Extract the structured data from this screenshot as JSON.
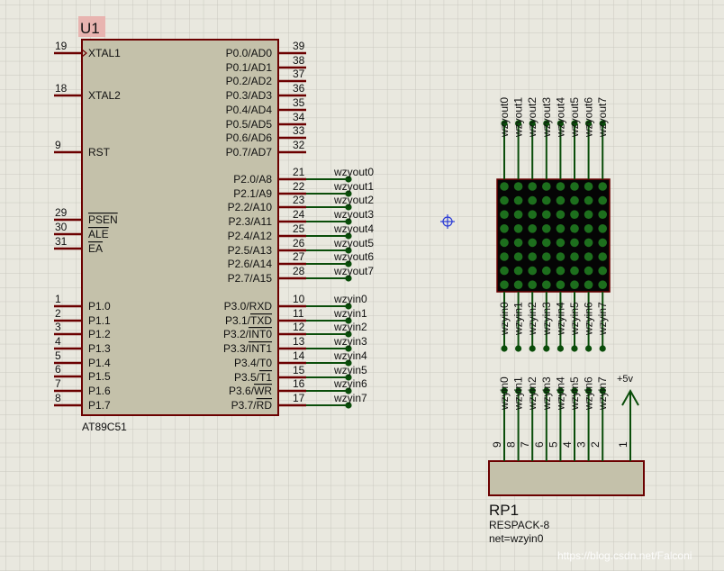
{
  "u1": {
    "ref": "U1",
    "part": "AT89C51",
    "left_pins": [
      {
        "num": "19",
        "name": "XTAL1",
        "clock": true
      },
      {
        "num": "18",
        "name": "XTAL2"
      },
      {
        "num": "9",
        "name": "RST"
      },
      {
        "num": "29",
        "name": "PSEN",
        "overbar": true
      },
      {
        "num": "30",
        "name": "ALE",
        "overbar": true
      },
      {
        "num": "31",
        "name": "EA",
        "overbar": true
      },
      {
        "num": "1",
        "name": "P1.0"
      },
      {
        "num": "2",
        "name": "P1.1"
      },
      {
        "num": "3",
        "name": "P1.2"
      },
      {
        "num": "4",
        "name": "P1.3"
      },
      {
        "num": "5",
        "name": "P1.4"
      },
      {
        "num": "6",
        "name": "P1.5"
      },
      {
        "num": "7",
        "name": "P1.6"
      },
      {
        "num": "8",
        "name": "P1.7"
      }
    ],
    "right_pins": [
      {
        "num": "39",
        "name": "P0.0/AD0"
      },
      {
        "num": "38",
        "name": "P0.1/AD1"
      },
      {
        "num": "37",
        "name": "P0.2/AD2"
      },
      {
        "num": "36",
        "name": "P0.3/AD3"
      },
      {
        "num": "35",
        "name": "P0.4/AD4"
      },
      {
        "num": "34",
        "name": "P0.5/AD5"
      },
      {
        "num": "33",
        "name": "P0.6/AD6"
      },
      {
        "num": "32",
        "name": "P0.7/AD7"
      },
      {
        "num": "21",
        "name": "P2.0/A8",
        "net": "wzyout0"
      },
      {
        "num": "22",
        "name": "P2.1/A9",
        "net": "wzyout1"
      },
      {
        "num": "23",
        "name": "P2.2/A10",
        "net": "wzyout2"
      },
      {
        "num": "24",
        "name": "P2.3/A11",
        "net": "wzyout3"
      },
      {
        "num": "25",
        "name": "P2.4/A12",
        "net": "wzyout4"
      },
      {
        "num": "26",
        "name": "P2.5/A13",
        "net": "wzyout5"
      },
      {
        "num": "27",
        "name": "P2.6/A14",
        "net": "wzyout6"
      },
      {
        "num": "28",
        "name": "P2.7/A15",
        "net": "wzyout7"
      },
      {
        "num": "10",
        "name": "P3.0/RXD",
        "net": "wzyin0"
      },
      {
        "num": "11",
        "name": "P3.1/TXD",
        "net": "wzyin1",
        "bar": "TXD"
      },
      {
        "num": "12",
        "name": "P3.2/INT0",
        "net": "wzyin2",
        "bar": "INT0"
      },
      {
        "num": "13",
        "name": "P3.3/INT1",
        "net": "wzyin3",
        "bar": "INT1"
      },
      {
        "num": "14",
        "name": "P3.4/T0",
        "net": "wzyin4"
      },
      {
        "num": "15",
        "name": "P3.5/T1",
        "net": "wzyin5",
        "bar": "T1"
      },
      {
        "num": "16",
        "name": "P3.6/WR",
        "net": "wzyin6",
        "bar": "WR"
      },
      {
        "num": "17",
        "name": "P3.7/RD",
        "net": "wzyin7",
        "bar": "RD"
      }
    ]
  },
  "matrix": {
    "top_nets": [
      "wzyout0",
      "wzyout1",
      "wzyout2",
      "wzyout3",
      "wzyout4",
      "wzyout5",
      "wzyout6",
      "wzyout7"
    ],
    "bottom_nets": [
      "wzyin0",
      "wzyin1",
      "wzyin2",
      "wzyin3",
      "wzyin4",
      "wzyin5",
      "wzyin6",
      "wzyin7"
    ],
    "rows": 8,
    "cols": 8,
    "dot_color": "#1d6f1d",
    "body_color": "#050505"
  },
  "rp1": {
    "ref": "RP1",
    "part": "RESPACK-8",
    "net_label": "net=wzyin0",
    "nets": [
      "wzyin0",
      "wzyin1",
      "wzyin2",
      "wzyin3",
      "wzyin4",
      "wzyin5",
      "wzyin6",
      "wzyin7"
    ],
    "pin_numbers": [
      "9",
      "8",
      "7",
      "6",
      "5",
      "4",
      "3",
      "2"
    ],
    "common_pin": "1",
    "power_label": "+5v"
  },
  "watermark": "https://blog.csdn.net/Falconi",
  "colors": {
    "background": "#e9e8df",
    "grid": "#c9c8bf",
    "wire": "#0a4d0a",
    "pin_line": "#6b0000",
    "body_fill": "#c4c1aa",
    "body_border": "#6b0000",
    "ref_highlight": "#e8b4b0",
    "probe": "#2a3bd6"
  }
}
